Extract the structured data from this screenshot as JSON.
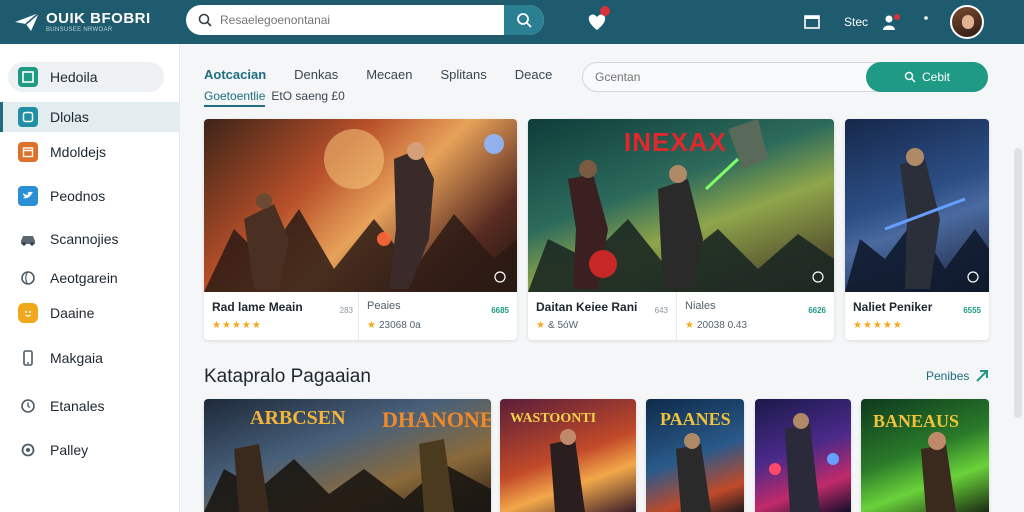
{
  "header": {
    "logo_title": "OUIK BFOBRI",
    "logo_sub": "BUNSUSEE NRWOAR",
    "search_placeholder": "Resaelegoenontanai",
    "top_label": "Stec"
  },
  "sidebar": {
    "items": [
      {
        "label": "Hedoila",
        "icon": "grid-icon",
        "color": "#1f9a84"
      },
      {
        "label": "Dlolas",
        "icon": "tablet-icon",
        "color": "#1f8fa3"
      },
      {
        "label": "Mdoldejs",
        "icon": "calendar-icon",
        "color": "#e0712b"
      },
      {
        "label": "Peodnos",
        "icon": "bird-icon",
        "color": "#2b8fd6"
      },
      {
        "label": "Scannojies",
        "icon": "car-icon",
        "color": "#5a6872"
      },
      {
        "label": "Aeotgarein",
        "icon": "globe-icon",
        "color": "#4d5b66"
      },
      {
        "label": "Daaine",
        "icon": "smile-icon",
        "color": "#f0a81c"
      },
      {
        "label": "Makgaia",
        "icon": "phone-icon",
        "color": "#4d5b66"
      },
      {
        "label": "Etanales",
        "icon": "clock-icon",
        "color": "#4d5b66"
      },
      {
        "label": "Palley",
        "icon": "gear-icon",
        "color": "#4d5b66"
      }
    ]
  },
  "main": {
    "tabs": [
      {
        "label": "Aotcacian"
      },
      {
        "label": "Denkas"
      },
      {
        "label": "Mecaen"
      },
      {
        "label": "Splitans"
      },
      {
        "label": "Deace"
      }
    ],
    "subline_link": "Goetoentlie",
    "subline_rest": "EtO saeng £0",
    "filter_placeholder": "Gcentan",
    "filter_button": "Cebit"
  },
  "featured": [
    {
      "title": "Rad lame Meain",
      "stars": "★★★★★",
      "count": "283",
      "sub": "Peaies",
      "meta": "23068 0a",
      "badge": "6685"
    },
    {
      "title": "Daitan Keiee Rani",
      "stars": "★",
      "count": "643",
      "sub": "Niales",
      "meta": "20038 0.43",
      "badge": "6626",
      "overlay": "INEXAX"
    },
    {
      "title": "Naliet Peniker",
      "stars": "★★★★★",
      "badge": "6555"
    }
  ],
  "section": {
    "title": "Katapralo Pagaaian",
    "link": "Penibes"
  },
  "lower_cards": [
    {
      "overlay": "ARBCSEN"
    },
    {
      "overlay": "DHANONE"
    },
    {
      "overlay": "WASTOONTI"
    },
    {
      "overlay": "PAANES"
    },
    {
      "overlay": ""
    },
    {
      "overlay": "BANEAUS"
    }
  ],
  "colors": {
    "header_bg": "#1f5b6e",
    "accent": "#1f6e80",
    "green": "#1f9a84",
    "star": "#f2a91a"
  }
}
